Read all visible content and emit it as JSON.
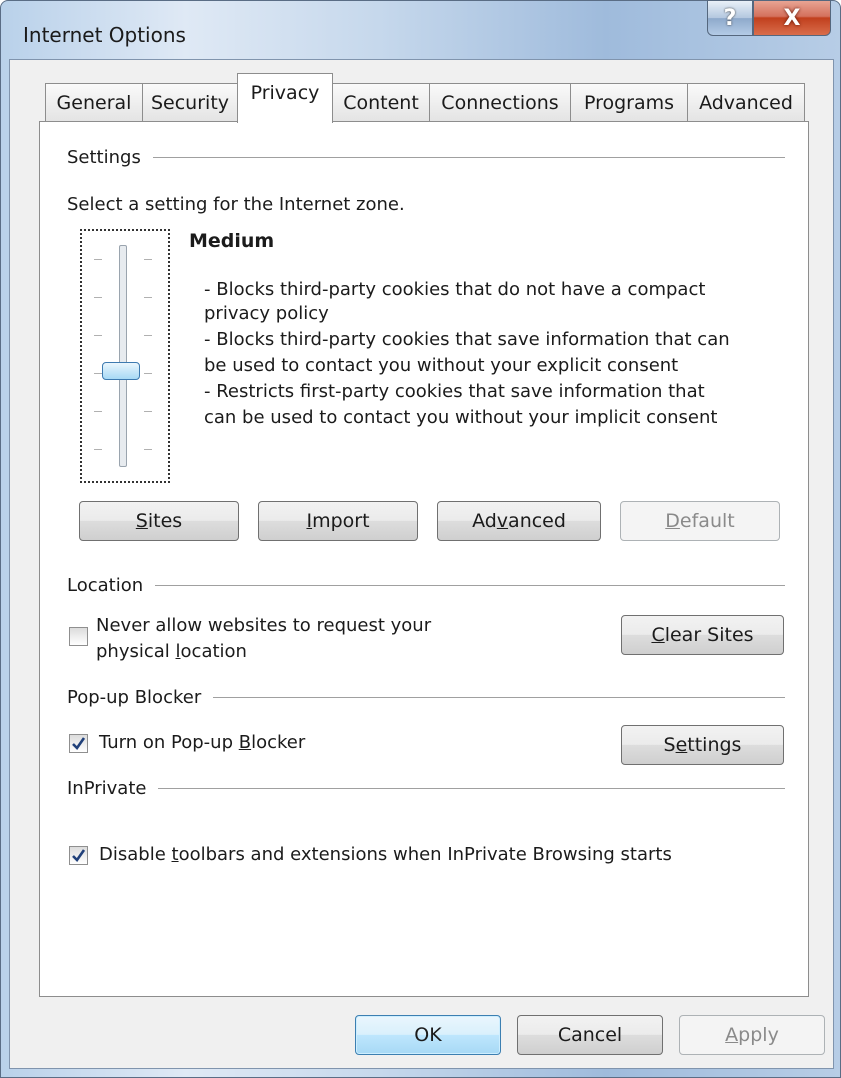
{
  "window": {
    "title": "Internet Options",
    "help_glyph": "?",
    "close_glyph": "X"
  },
  "tabs": [
    {
      "label": "General"
    },
    {
      "label": "Security"
    },
    {
      "label": "Privacy"
    },
    {
      "label": "Content"
    },
    {
      "label": "Connections"
    },
    {
      "label": "Programs"
    },
    {
      "label": "Advanced"
    }
  ],
  "active_tab": "Privacy",
  "settings": {
    "group_label": "Settings",
    "zone_text": "Select a setting for the Internet zone.",
    "level": "Medium",
    "slider_position": "3 of 6 (middle)",
    "description_lines": [
      "- Blocks third-party cookies that do not have a compact",
      "privacy policy",
      "- Blocks third-party cookies that save information that can",
      "be used to contact you without your explicit consent",
      "- Restricts first-party cookies that save information that",
      "can be used to contact you without your implicit consent"
    ],
    "buttons": {
      "sites": {
        "pre": "",
        "key": "S",
        "post": "ites"
      },
      "import": {
        "pre": "",
        "key": "I",
        "post": "mport"
      },
      "advanced": {
        "pre": "Ad",
        "key": "v",
        "post": "anced"
      },
      "default": {
        "pre": "",
        "key": "D",
        "post": "efault"
      }
    }
  },
  "location": {
    "group_label": "Location",
    "checkbox_line1": "Never allow websites to request your",
    "checkbox_line2": {
      "pre": "physical ",
      "key": "l",
      "post": "ocation"
    },
    "checked": false,
    "clear_sites": {
      "pre": "",
      "key": "C",
      "post": "lear Sites"
    }
  },
  "popup": {
    "group_label": "Pop-up Blocker",
    "checkbox_label": {
      "pre": "Turn on Pop-up ",
      "key": "B",
      "post": "locker"
    },
    "checked": true,
    "settings_button": {
      "pre": "S",
      "key": "e",
      "post": "ttings"
    }
  },
  "inprivate": {
    "group_label": "InPrivate",
    "checkbox_label": {
      "pre": "Disable ",
      "key": "t",
      "post": "oolbars and extensions when InPrivate Browsing starts"
    },
    "checked": true
  },
  "footer": {
    "ok": "OK",
    "cancel": "Cancel",
    "apply": {
      "pre": "",
      "key": "A",
      "post": "pply"
    }
  },
  "colors": {
    "accent": "#3c7fb1",
    "close": "#c1401e",
    "disabled_text": "#8a8a8a"
  },
  "icons": {
    "help": "help-icon",
    "close": "close-icon",
    "check": "checkmark-icon"
  }
}
